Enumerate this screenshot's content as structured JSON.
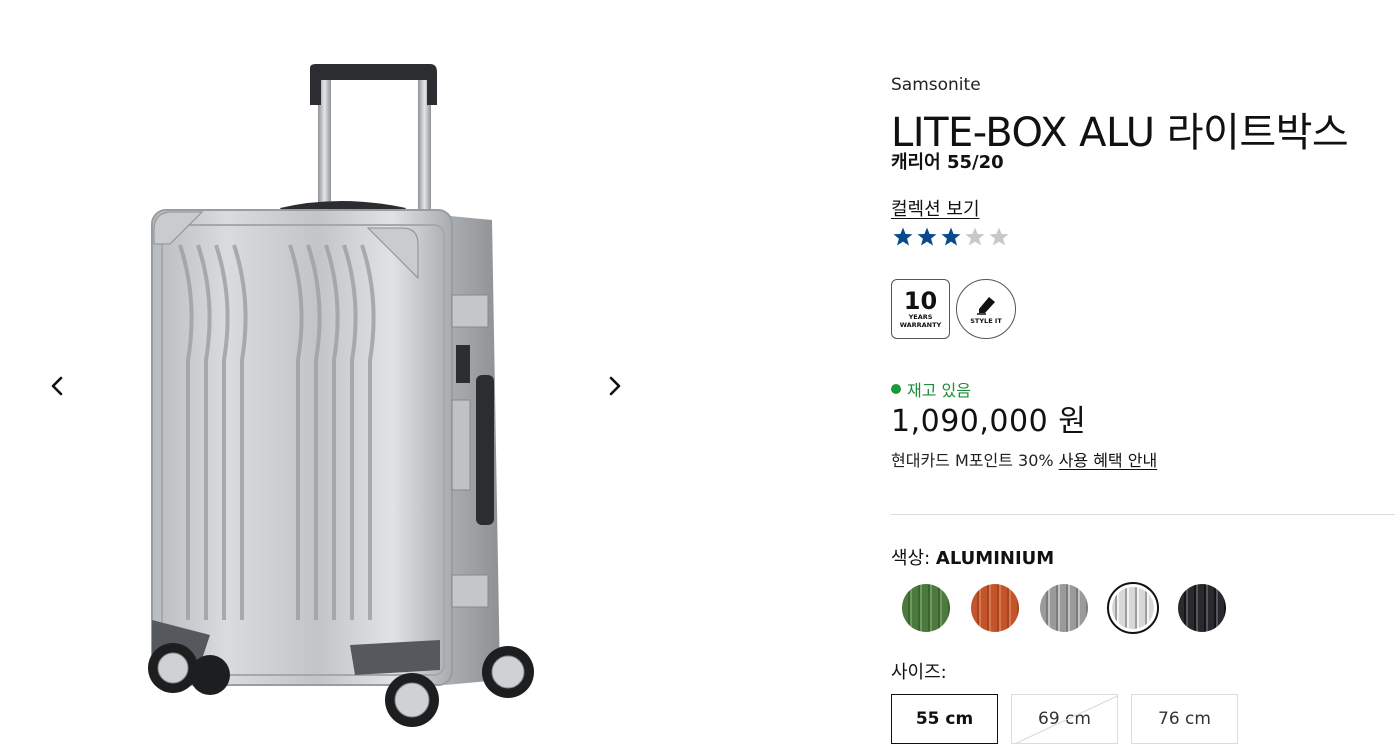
{
  "gallery": {
    "prev_icon": "chevron-left-icon",
    "next_icon": "chevron-right-icon",
    "image": "silver aluminium suitcase"
  },
  "product": {
    "brand": "Samsonite",
    "title": "LITE-BOX ALU 라이트박스",
    "subtitle": "캐리어 55/20",
    "collection_link": "컬렉션 보기",
    "rating": 3,
    "rating_max": 5,
    "star_color": "#0a4a8c",
    "star_empty_color": "#c8c8c8"
  },
  "badges": {
    "warranty_number": "10",
    "warranty_line1": "YEARS",
    "warranty_line2": "WARRANTY",
    "style_label": "STYLE IT"
  },
  "stock": {
    "label": "재고 있음",
    "color": "#1a9a3a"
  },
  "price": {
    "value": "1,090,000 원"
  },
  "promo": {
    "text": "현대카드 M포인트 30%",
    "link": "사용 혜택 안내"
  },
  "color": {
    "label": "색상:",
    "selected": "ALUMINIUM",
    "options": [
      {
        "name": "green",
        "color": "#4c7a3e"
      },
      {
        "name": "copper",
        "color": "#c2552c"
      },
      {
        "name": "grey",
        "color": "#9a9a9a"
      },
      {
        "name": "aluminium",
        "color": "#d8d8d8"
      },
      {
        "name": "black",
        "color": "#2a2a2e"
      }
    ]
  },
  "size": {
    "label": "사이즈:",
    "options": [
      {
        "label": "55 cm",
        "state": "selected"
      },
      {
        "label": "69 cm",
        "state": "unavailable"
      },
      {
        "label": "76 cm",
        "state": "available"
      }
    ]
  }
}
